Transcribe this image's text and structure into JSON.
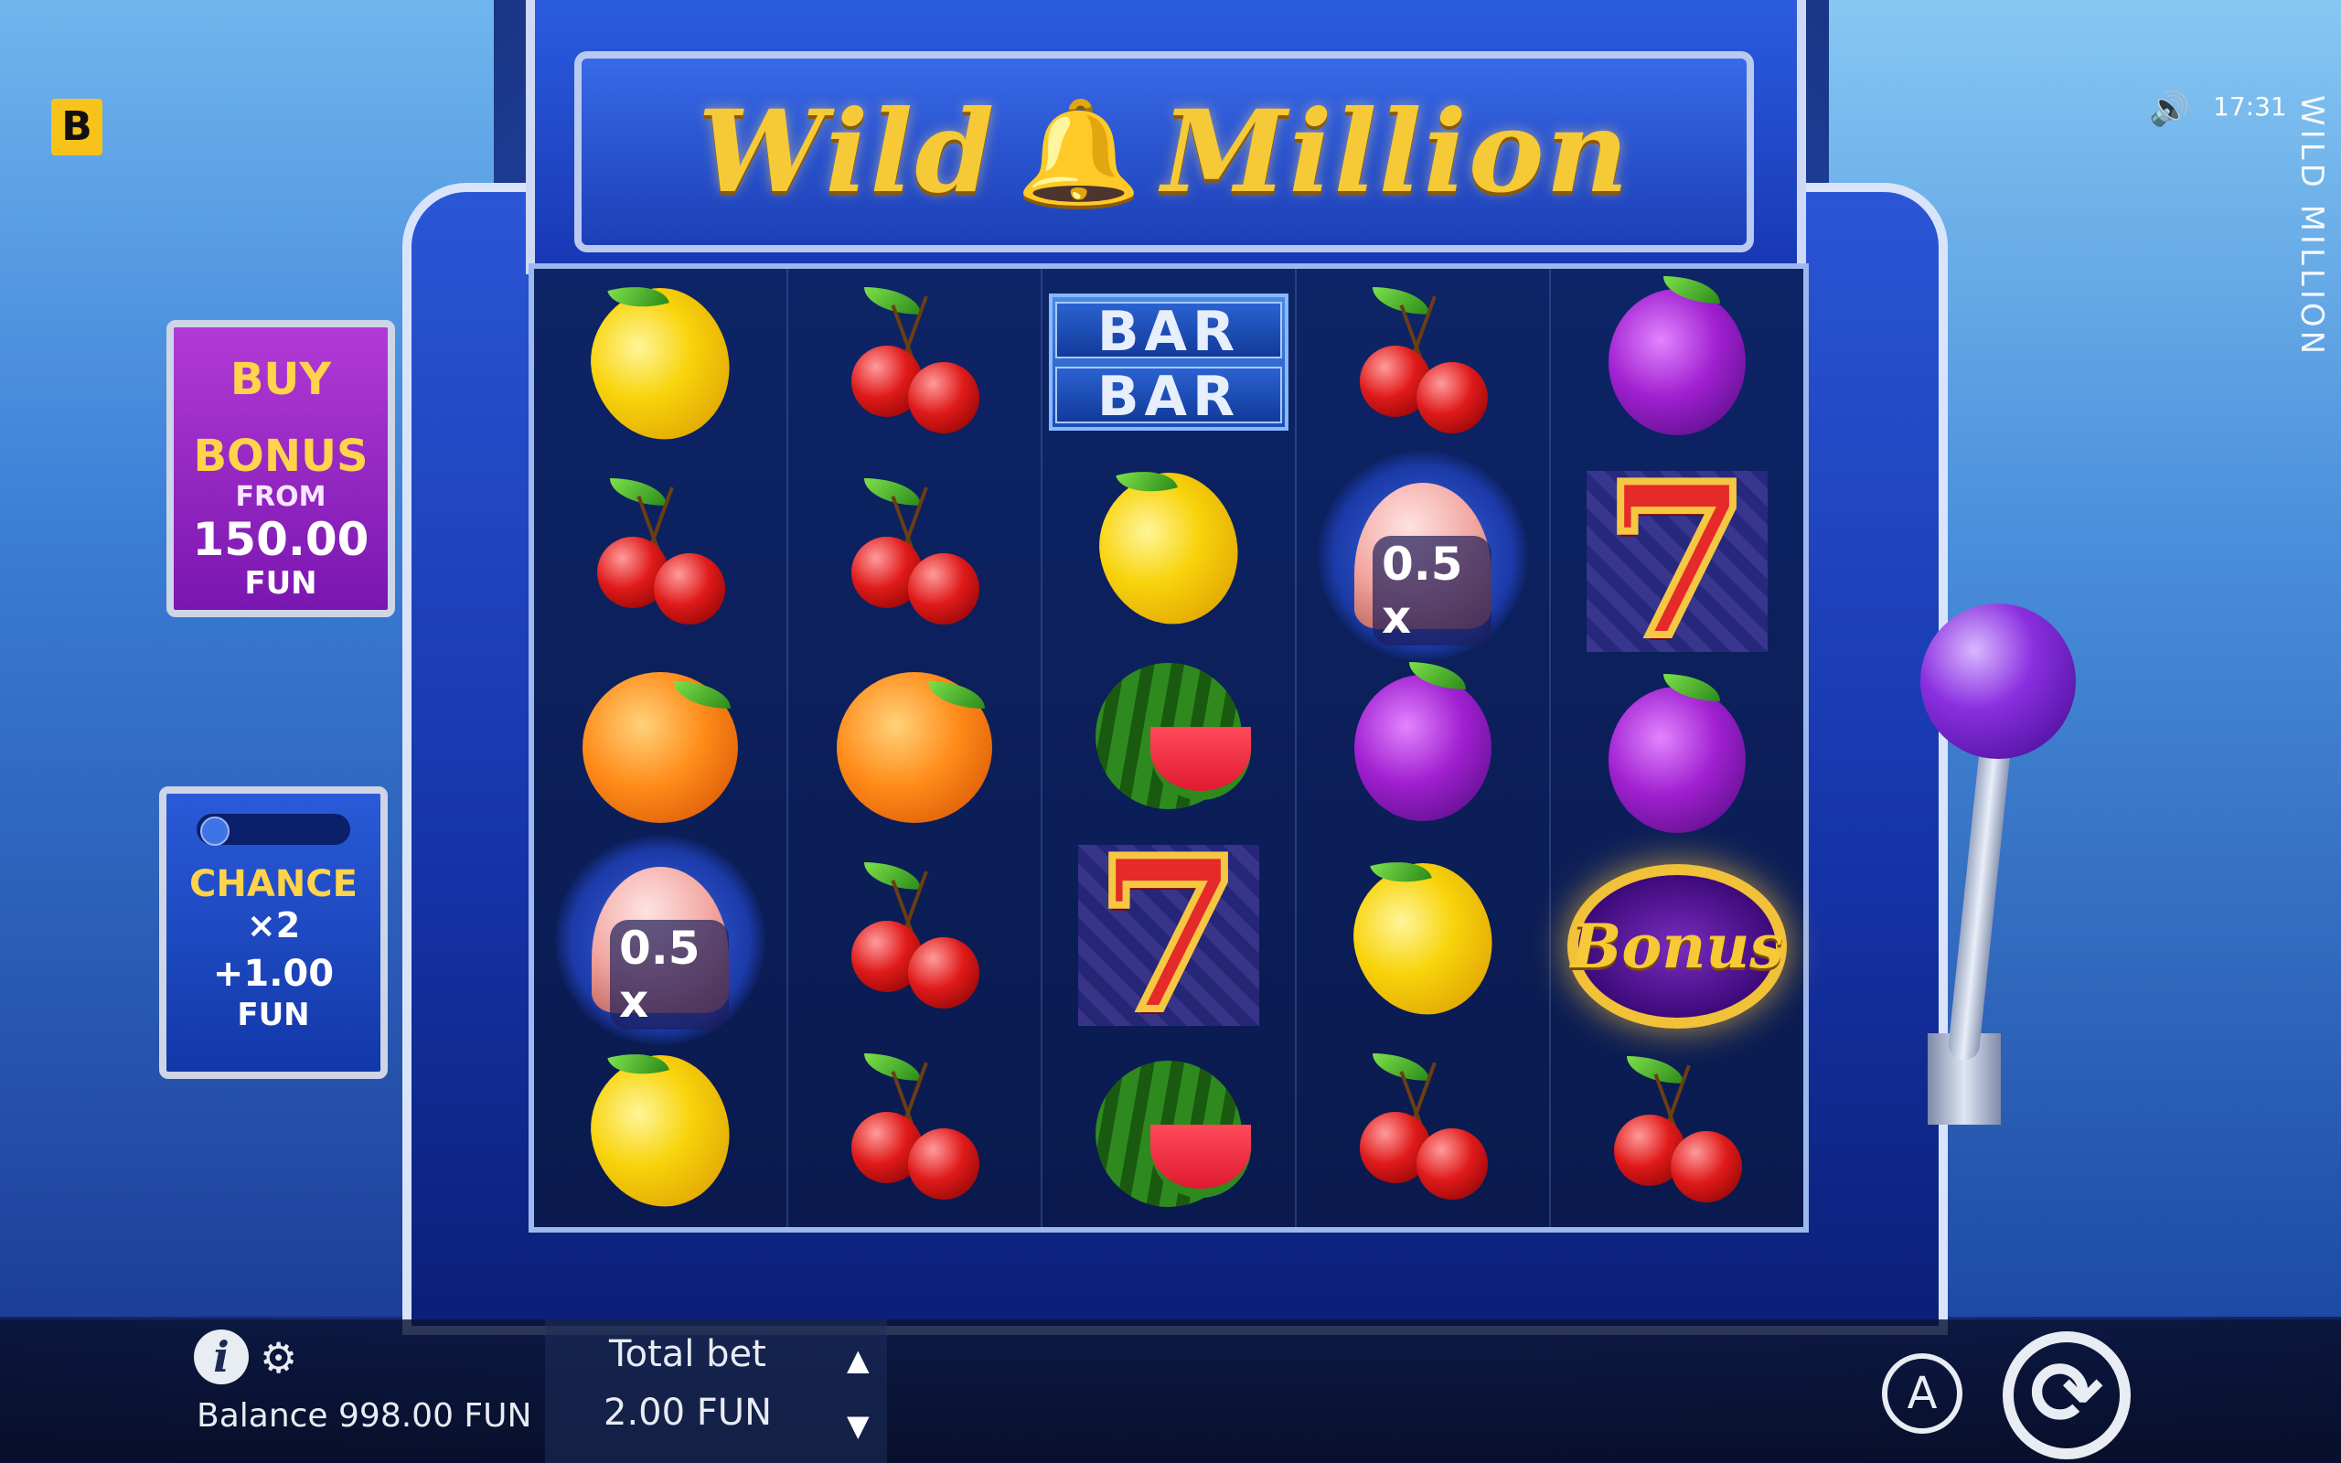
{
  "app": {
    "brand_logo": "B",
    "title_part1": "Wild",
    "title_part2": "Million",
    "vertical_title": "WILD MILLION",
    "clock": "17:31"
  },
  "buy_bonus": {
    "line1": "BUY",
    "line2": "BONUS",
    "from": "FROM",
    "amount": "150.00",
    "currency": "FUN"
  },
  "chance": {
    "line1": "CHANCE",
    "line2": "×2",
    "amount": "+1.00",
    "currency": "FUN",
    "toggle_on": false
  },
  "reels": [
    [
      {
        "symbol": "lemon"
      },
      {
        "symbol": "cherry"
      },
      {
        "symbol": "orange"
      },
      {
        "symbol": "bell",
        "multiplier": "0.5 x"
      },
      {
        "symbol": "lemon"
      }
    ],
    [
      {
        "symbol": "cherry"
      },
      {
        "symbol": "cherry"
      },
      {
        "symbol": "orange"
      },
      {
        "symbol": "cherry"
      },
      {
        "symbol": "cherry"
      }
    ],
    [
      {
        "symbol": "bar-bar",
        "text": "BAR"
      },
      {
        "symbol": "lemon"
      },
      {
        "symbol": "watermelon"
      },
      {
        "symbol": "seven",
        "text": "7"
      },
      {
        "symbol": "watermelon"
      }
    ],
    [
      {
        "symbol": "cherry"
      },
      {
        "symbol": "bell",
        "multiplier": "0.5 x"
      },
      {
        "symbol": "plum"
      },
      {
        "symbol": "lemon"
      },
      {
        "symbol": "cherry"
      }
    ],
    [
      {
        "symbol": "plum"
      },
      {
        "symbol": "seven",
        "text": "7"
      },
      {
        "symbol": "plum"
      },
      {
        "symbol": "bonus",
        "text": "Bonus"
      },
      {
        "symbol": "cherry"
      }
    ]
  ],
  "bottom": {
    "balance": "Balance 998.00 FUN",
    "bet_label": "Total bet",
    "bet_value": "2.00 FUN",
    "autoplay_label": "A"
  },
  "colors": {
    "title_gold": "#f6c937",
    "buy_bonus_bg": "#b23ad6",
    "chance_bg": "#2a5ad8",
    "machine_blue": "#1533a8"
  }
}
